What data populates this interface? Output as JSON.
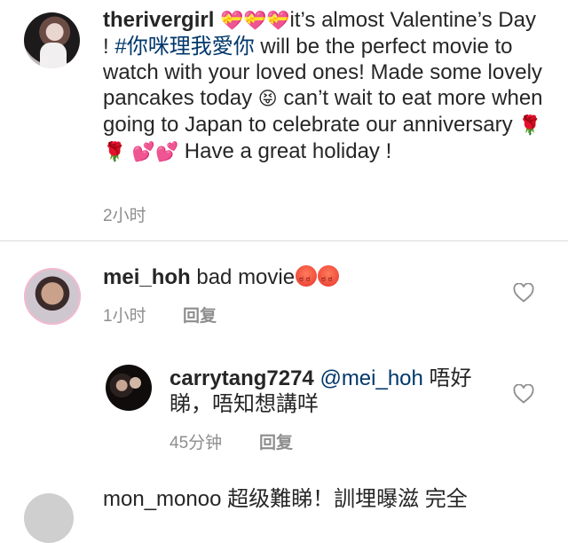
{
  "caption": {
    "username": "therivergirl",
    "text_before_hashtag": "it’s almost Valentine’s Day ! ",
    "hashtag": "#你咪理我愛你",
    "text_after_hashtag": " will be the perfect movie to watch with your loved ones! Made some lovely pancakes today ",
    "text_middle": " can’t wait to eat more when going to Japan to celebrate our anniversary ",
    "text_end": " Have a great holiday !",
    "emoji_gift_hearts": "💝💝💝",
    "emoji_tongue": "😝",
    "emoji_roses": "🌹 🌹",
    "emoji_hearts": "💕💕",
    "timestamp": "2小时"
  },
  "comments": [
    {
      "username": "mei_hoh",
      "text": " bad movie",
      "emoji": "😠😠",
      "timestamp": "1小时",
      "reply_label": "回复"
    },
    {
      "username": "carrytang7274",
      "mention": "@mei_hoh",
      "text_line1": " 唔好",
      "text_line2": "睇，唔知想講咩",
      "timestamp": "45分钟",
      "reply_label": "回复"
    }
  ],
  "next_comment_partial": "mon_monoo 超级難睇！訓埋曝滋  完全"
}
